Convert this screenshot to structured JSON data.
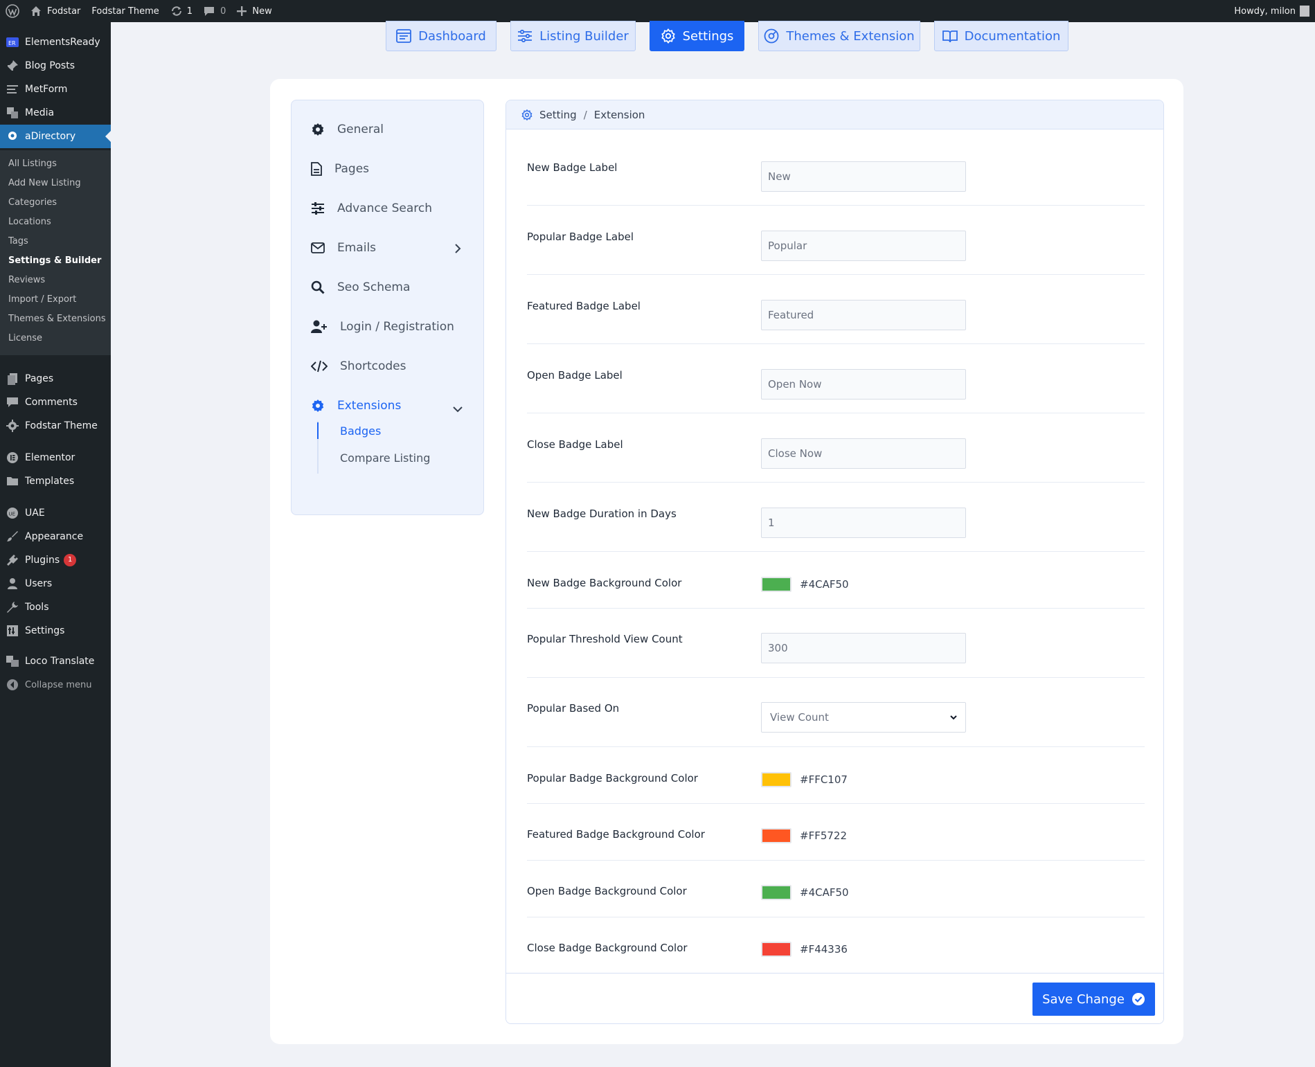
{
  "adminbar": {
    "site_name": "Fodstar",
    "theme_name": "Fodstar Theme",
    "updates_count": "1",
    "comments_count": "0",
    "new_label": "New",
    "howdy": "Howdy, milon"
  },
  "sidebar": {
    "items": [
      {
        "label": "ElementsReady",
        "icon": "elementsready-icon"
      },
      {
        "label": "Blog Posts",
        "icon": "pin-icon"
      },
      {
        "label": "MetForm",
        "icon": "form-icon"
      },
      {
        "label": "Media",
        "icon": "media-icon"
      },
      {
        "label": "aDirectory",
        "icon": "directory-icon"
      },
      {
        "label": "Pages",
        "icon": "pages-icon"
      },
      {
        "label": "Comments",
        "icon": "comment-icon"
      },
      {
        "label": "Fodstar Theme",
        "icon": "gear-icon"
      },
      {
        "label": "Elementor",
        "icon": "elementor-icon"
      },
      {
        "label": "Templates",
        "icon": "folder-icon"
      },
      {
        "label": "UAE",
        "icon": "uae-icon"
      },
      {
        "label": "Appearance",
        "icon": "brush-icon"
      },
      {
        "label": "Plugins",
        "icon": "plugin-icon",
        "badge": "1"
      },
      {
        "label": "Users",
        "icon": "user-icon"
      },
      {
        "label": "Tools",
        "icon": "wrench-icon"
      },
      {
        "label": "Settings",
        "icon": "settings-icon"
      },
      {
        "label": "Loco Translate",
        "icon": "translate-icon"
      },
      {
        "label": "Collapse menu",
        "icon": "collapse-icon"
      }
    ],
    "submenu": [
      "All Listings",
      "Add New Listing",
      "Categories",
      "Locations",
      "Tags",
      "Settings & Builder",
      "Reviews",
      "Import / Export",
      "Themes & Extensions",
      "License"
    ]
  },
  "tabs": [
    {
      "label": "Dashboard",
      "icon": "dashboard-icon"
    },
    {
      "label": "Listing Builder",
      "icon": "sliders-icon"
    },
    {
      "label": "Settings",
      "icon": "gear-icon"
    },
    {
      "label": "Themes & Extension",
      "icon": "palette-icon"
    },
    {
      "label": "Documentation",
      "icon": "book-icon"
    }
  ],
  "settings_nav": {
    "items": [
      {
        "label": "General",
        "icon": "gear-icon"
      },
      {
        "label": "Pages",
        "icon": "file-icon"
      },
      {
        "label": "Advance Search",
        "icon": "sliders-icon"
      },
      {
        "label": "Emails",
        "icon": "envelope-icon"
      },
      {
        "label": "Seo Schema",
        "icon": "search-icon"
      },
      {
        "label": "Login / Registration",
        "icon": "user-plus-icon"
      },
      {
        "label": "Shortcodes",
        "icon": "code-icon"
      },
      {
        "label": "Extensions",
        "icon": "gear-icon"
      }
    ],
    "sub_items": [
      "Badges",
      "Compare Listing"
    ]
  },
  "breadcrumb": {
    "first": "Setting",
    "separator": "/",
    "second": "Extension"
  },
  "form": {
    "new_badge_label": {
      "label": "New Badge Label",
      "value": "New"
    },
    "popular_badge_label": {
      "label": "Popular Badge Label",
      "value": "Popular"
    },
    "featured_badge_label": {
      "label": "Featured Badge Label",
      "value": "Featured"
    },
    "open_badge_label": {
      "label": "Open Badge Label",
      "value": "Open Now"
    },
    "close_badge_label": {
      "label": "Close Badge Label",
      "value": "Close Now"
    },
    "new_badge_duration": {
      "label": "New Badge Duration in Days",
      "value": "1"
    },
    "new_badge_bg": {
      "label": "New Badge Background Color",
      "value": "#4CAF50"
    },
    "popular_threshold": {
      "label": "Popular Threshold View Count",
      "value": "300"
    },
    "popular_based_on": {
      "label": "Popular Based On",
      "value": "View Count"
    },
    "popular_badge_bg": {
      "label": "Popular Badge Background Color",
      "value": "#FFC107"
    },
    "featured_badge_bg": {
      "label": "Featured Badge Background Color",
      "value": "#FF5722"
    },
    "open_badge_bg": {
      "label": "Open Badge Background Color",
      "value": "#4CAF50"
    },
    "close_badge_bg": {
      "label": "Close Badge Background Color",
      "value": "#F44336"
    }
  },
  "save_label": "Save Change",
  "colors": {
    "accent": "#1c64f2",
    "admin_dark": "#1d2327",
    "admin_highlight": "#2271b1"
  }
}
